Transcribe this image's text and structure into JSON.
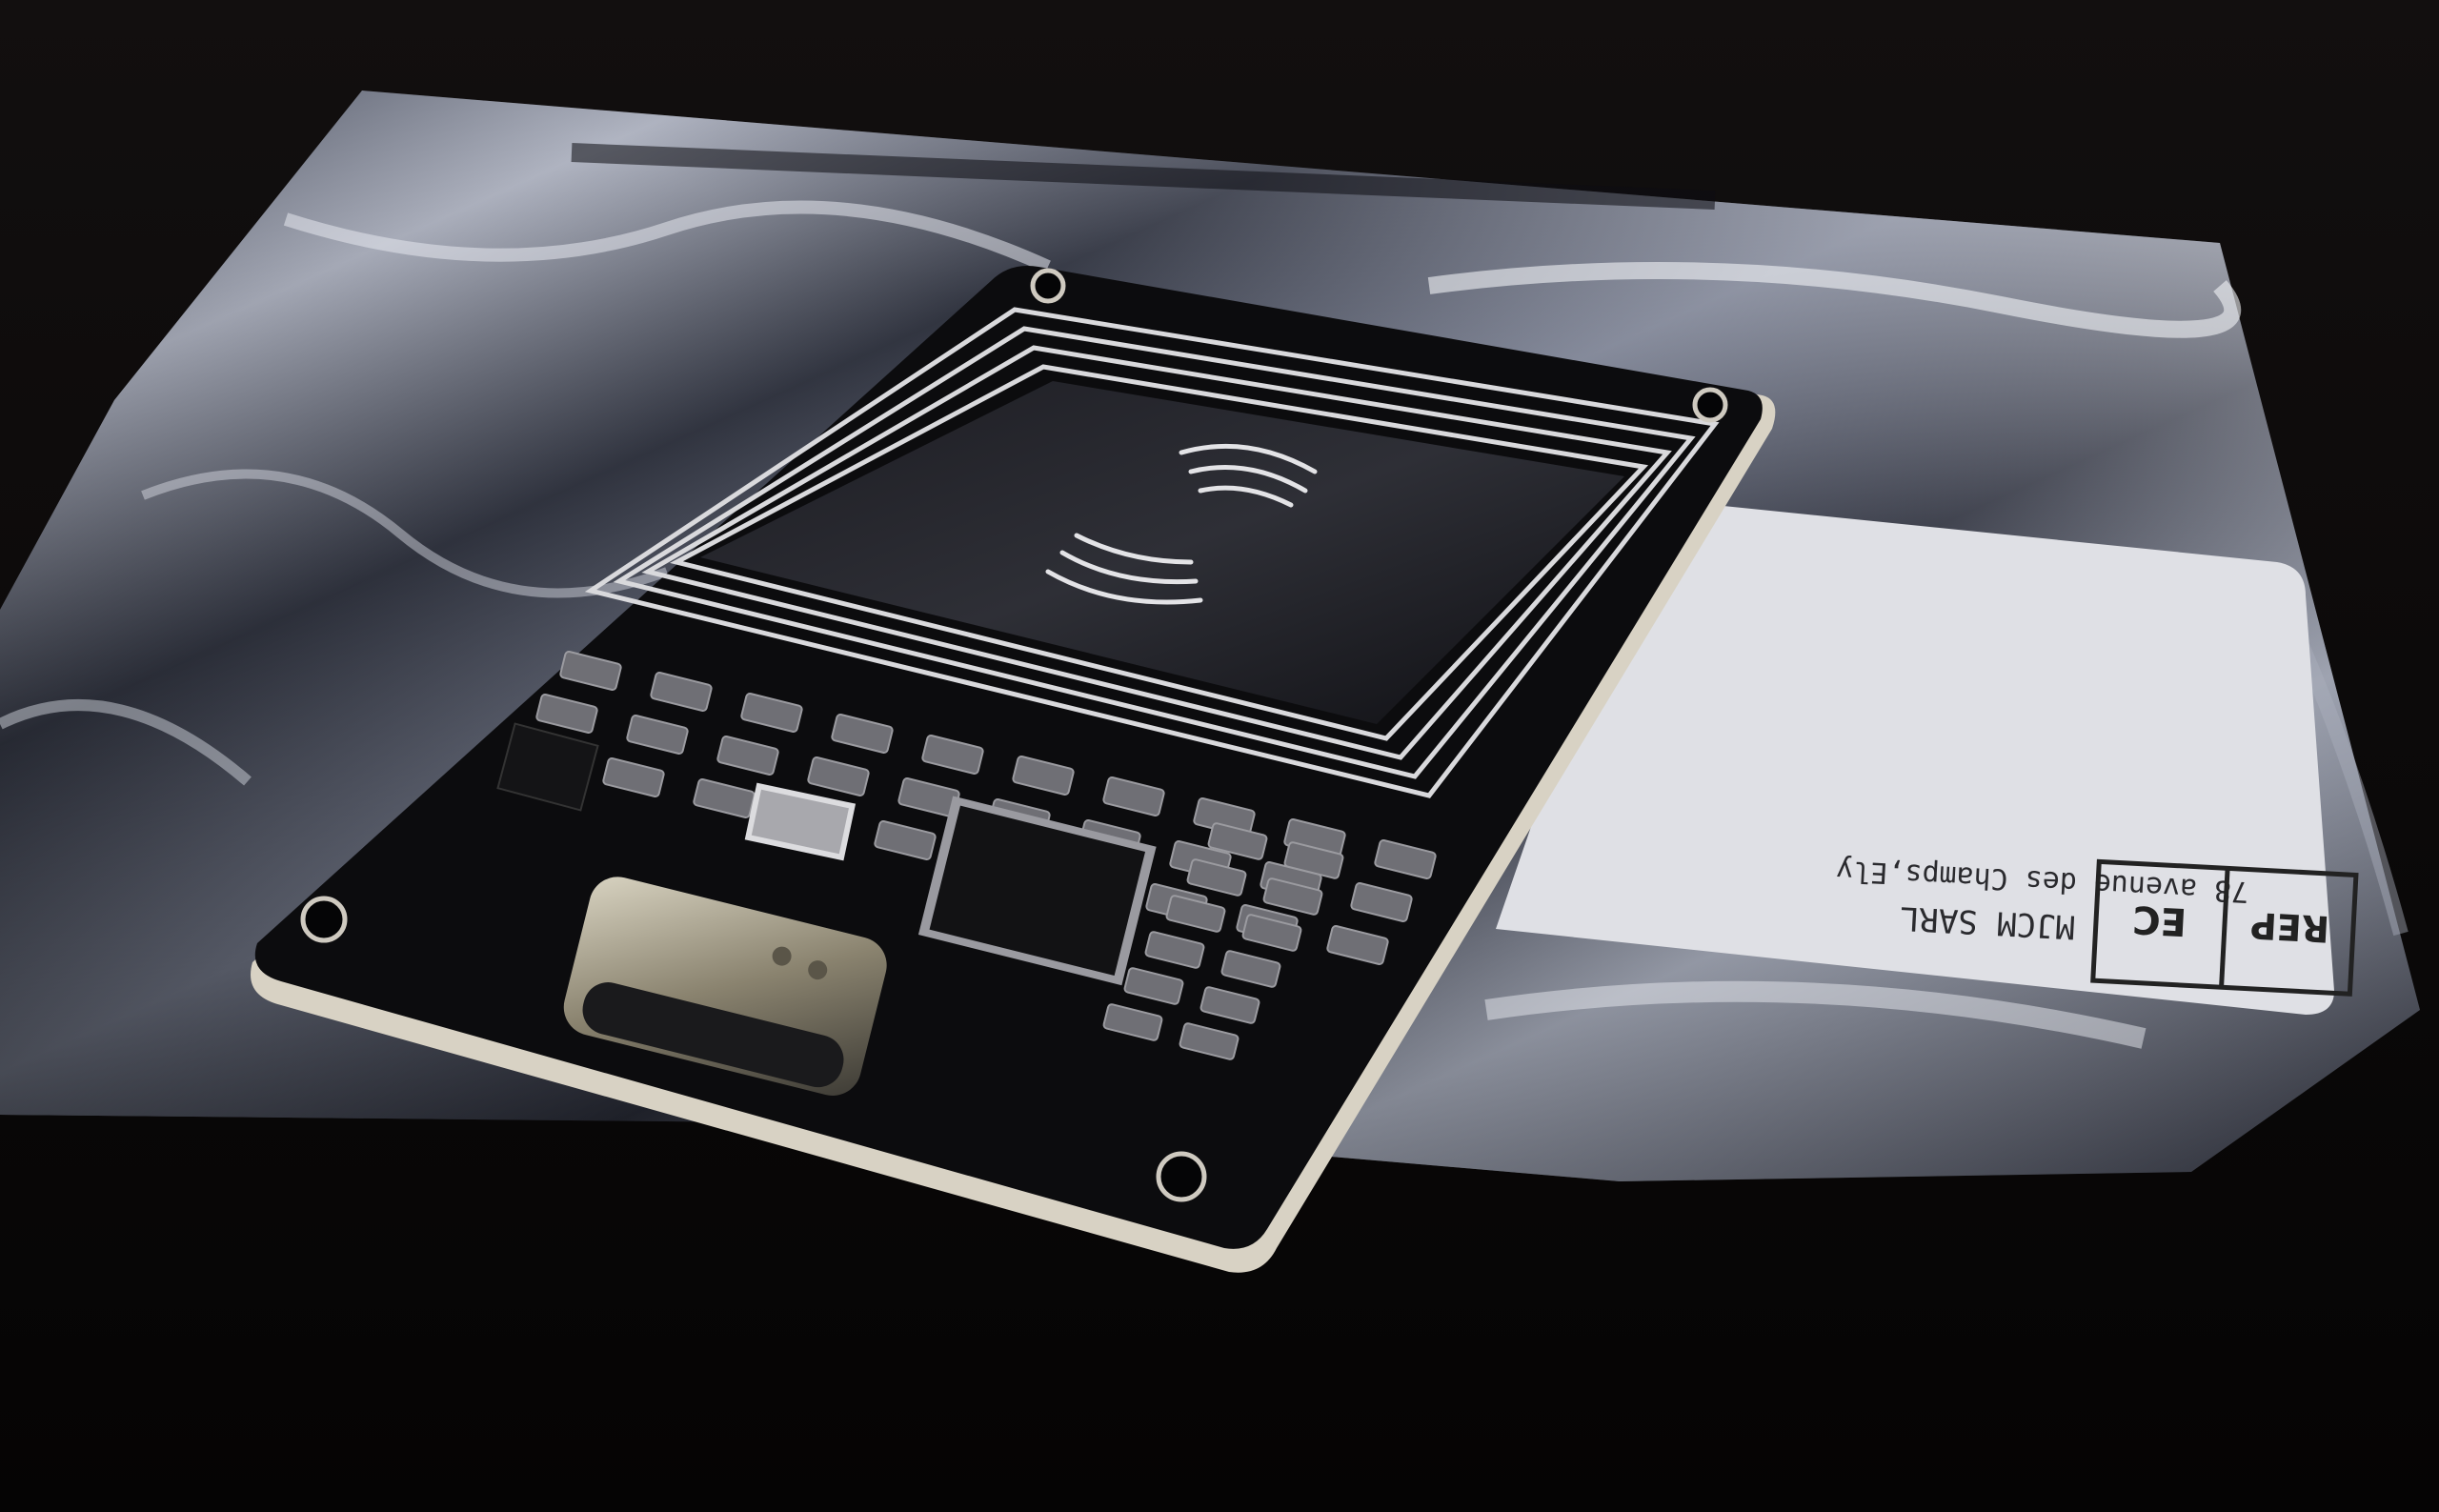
{
  "photo": {
    "subject": "nfc-reader-pcb-on-antistatic-bag",
    "colors": {
      "background": "#0d0b0b",
      "bag_highlight": "#c9cdd8",
      "bag_shadow": "#1a1c24",
      "pcb": "#0c0c0e",
      "pcb_edge": "#d8d2c4",
      "label": "#dfe0e5"
    }
  },
  "label": {
    "company": "MJCM SARL",
    "address": "78 avenue des Champs,Ely",
    "ec_symbol": "EC",
    "rep_symbol": "REP"
  }
}
